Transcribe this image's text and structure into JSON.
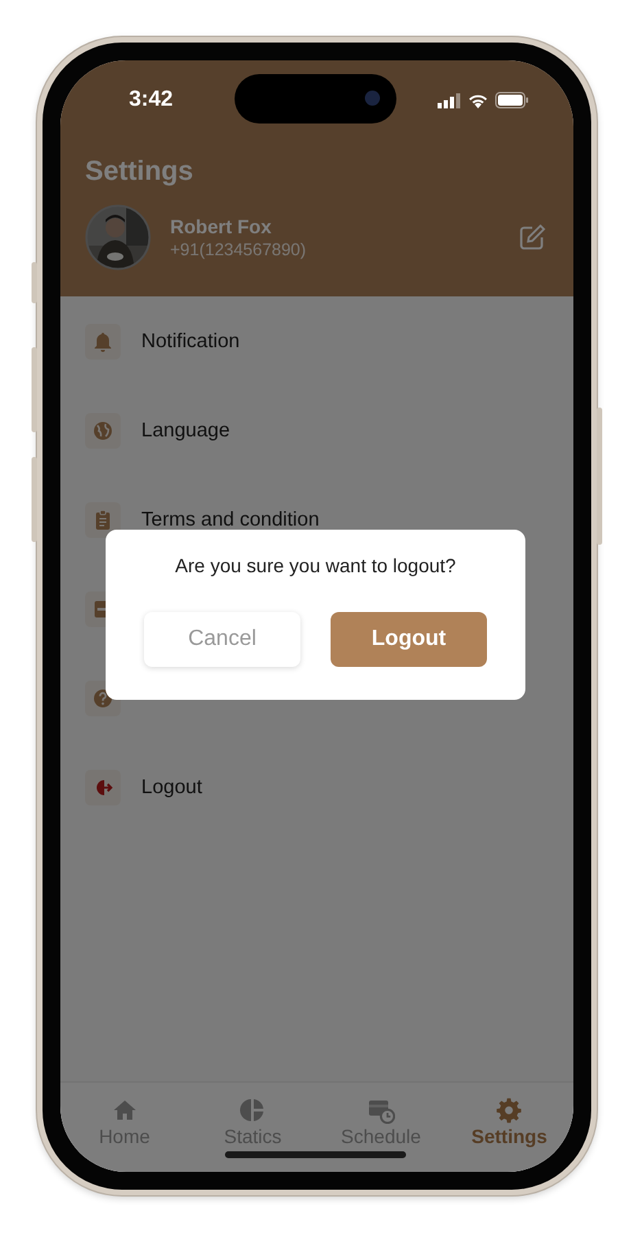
{
  "status_bar": {
    "time": "3:42"
  },
  "header": {
    "title": "Settings",
    "profile": {
      "name": "Robert Fox",
      "phone": "+91(1234567890)"
    }
  },
  "menu": [
    {
      "label": "Notification",
      "kind": "bell"
    },
    {
      "label": "Language",
      "kind": "globe"
    },
    {
      "label": "Terms and condition",
      "kind": "clipboard"
    },
    {
      "kind": "card"
    },
    {
      "kind": "help"
    },
    {
      "label": "Logout",
      "kind": "logout"
    }
  ],
  "dialog": {
    "message": "Are you sure you want to logout?",
    "buttons": [
      {
        "label": "Cancel",
        "kind": "secondary"
      },
      {
        "label": "Logout",
        "kind": "primary"
      }
    ]
  },
  "tabs": [
    {
      "label": "Home",
      "kind": "home",
      "selected": false
    },
    {
      "label": "Statics",
      "kind": "pie",
      "selected": false
    },
    {
      "label": "Schedule",
      "kind": "schedule",
      "selected": false
    },
    {
      "label": "Settings",
      "kind": "gear",
      "selected": true
    }
  ]
}
